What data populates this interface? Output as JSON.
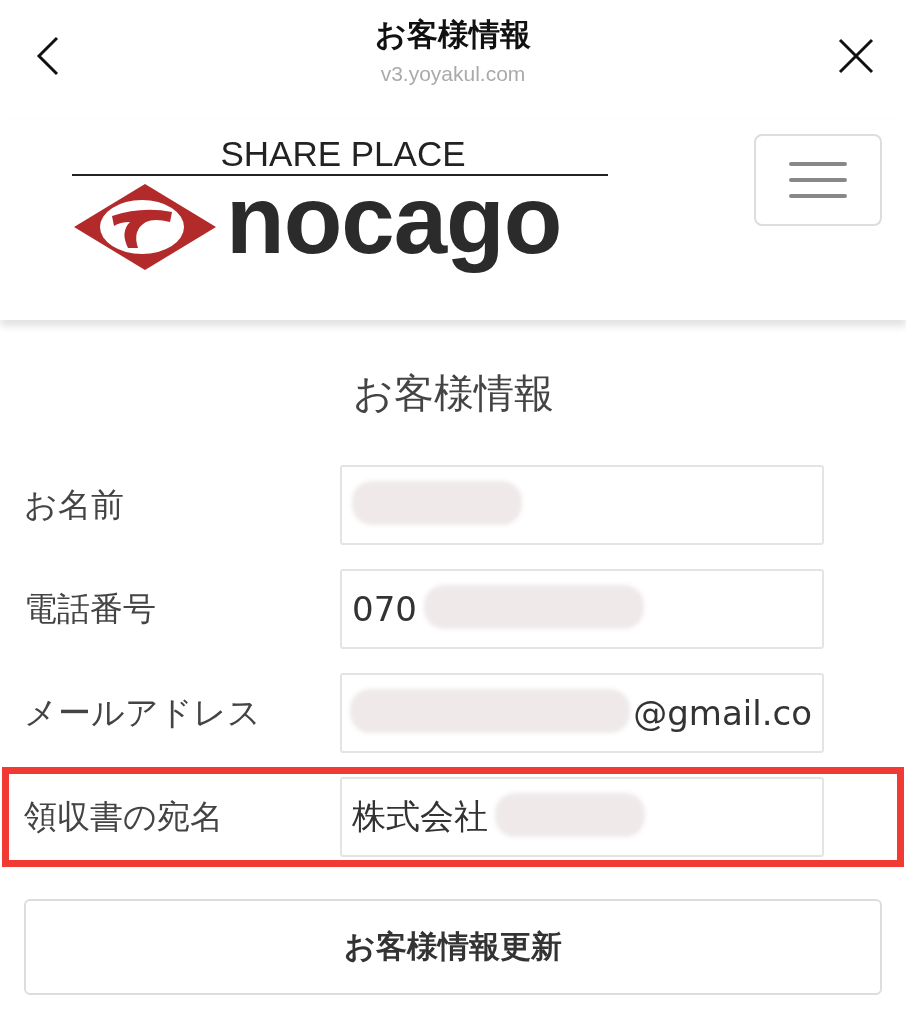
{
  "top_bar": {
    "title": "お客様情報",
    "url": "v3.yoyakul.com"
  },
  "logo": {
    "tagline": "SHARE PLACE",
    "wordmark": "nocago"
  },
  "heading": "お客様情報",
  "fields": [
    {
      "label": "お名前",
      "redacted": true,
      "highlighted": false
    },
    {
      "label": "電話番号",
      "value": "070",
      "redacted": true,
      "highlighted": false
    },
    {
      "label": "メールアドレス",
      "value": "@gmail.co",
      "redacted": true,
      "highlighted": false
    },
    {
      "label": "領収書の宛名",
      "value": "株式会社",
      "redacted": true,
      "highlighted": true
    }
  ],
  "submit_button": "お客様情報更新"
}
